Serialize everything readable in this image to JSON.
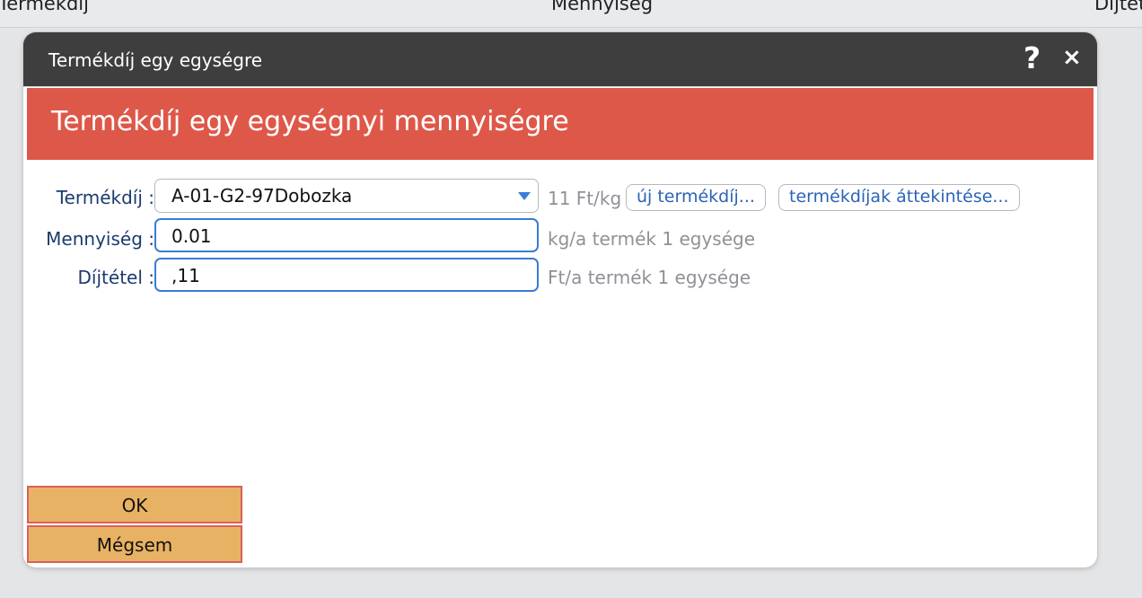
{
  "background_table": {
    "columns": [
      "Termékdíj",
      "Mennyiség",
      "Díjtét"
    ]
  },
  "dialog": {
    "title": "Termékdíj egy egységre",
    "help_glyph": "?",
    "close_glyph": "×",
    "heading": "Termékdíj egy egységnyi mennyiségre",
    "form": {
      "product_fee": {
        "label": "Termékdíj :",
        "value": "A-01-G2-97Dobozka",
        "unit_hint": "11 Ft/kg",
        "new_button": "új termékdíj...",
        "overview_button": "termékdíjak áttekintése..."
      },
      "quantity": {
        "label": "Mennyiség :",
        "value": "0.01",
        "unit_hint": "kg/a termék 1 egysége"
      },
      "fee_rate": {
        "label": "Díjtétel :",
        "value": ",11",
        "unit_hint": "Ft/a termék 1 egysége"
      }
    },
    "buttons": {
      "ok": "OK",
      "cancel": "Mégsem"
    }
  },
  "colors": {
    "titlebar": "#3e3e3e",
    "banner": "#de5849",
    "button": "#e8b264",
    "button_border": "#d9605b",
    "label": "#1b3b6f",
    "link": "#2b63b8",
    "focus": "#3c7ad8"
  }
}
